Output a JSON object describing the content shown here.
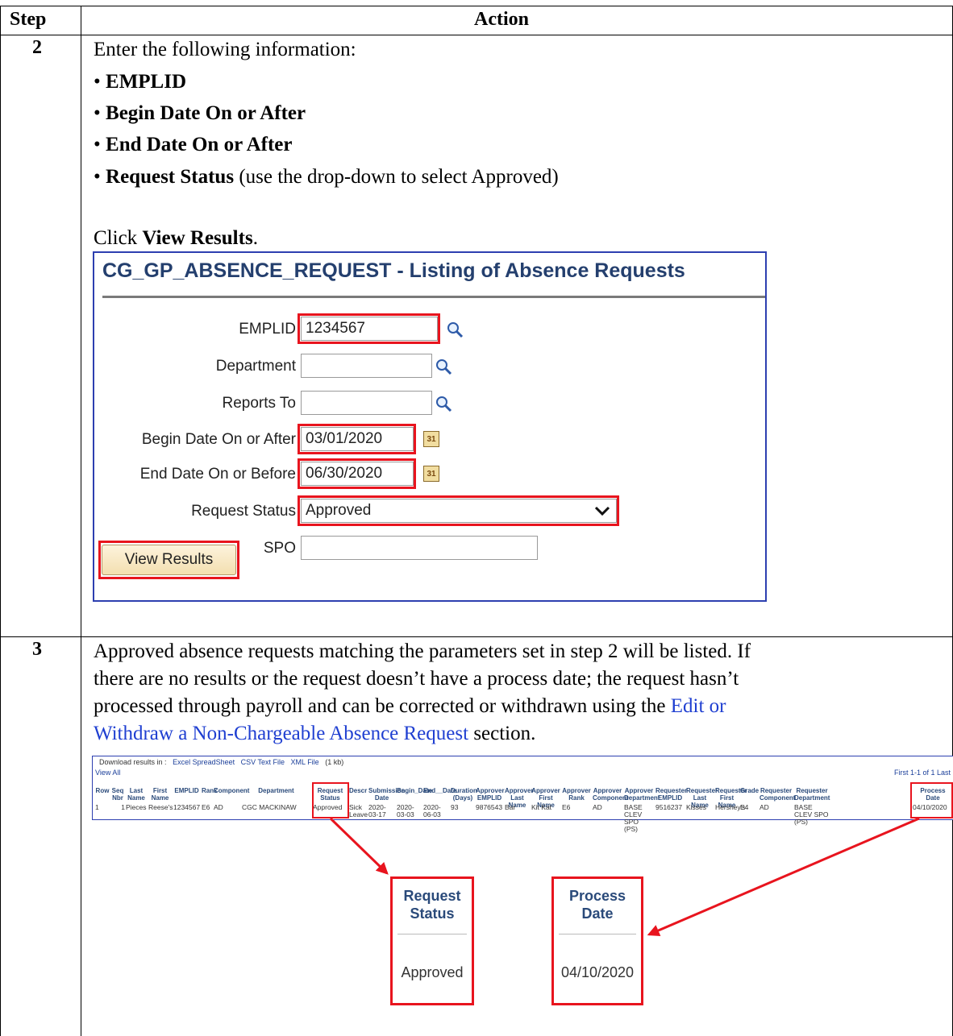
{
  "table": {
    "headers": {
      "step": "Step",
      "action": "Action"
    }
  },
  "step2": {
    "number": "2",
    "intro": "Enter the following information:",
    "bullets": [
      {
        "bold": "EMPLID",
        "rest": ""
      },
      {
        "bold": "Begin Date On or After",
        "rest": ""
      },
      {
        "bold": "End Date On or After",
        "rest": ""
      },
      {
        "bold": "Request Status",
        "rest": " (use the drop-down to select Approved)"
      }
    ],
    "click_prefix": "Click ",
    "click_bold": "View Results",
    "click_suffix": ".",
    "panel": {
      "title": "CG_GP_ABSENCE_REQUEST - Listing of Absence Requests",
      "fields": {
        "emplid": {
          "label": "EMPLID",
          "value": "1234567"
        },
        "department": {
          "label": "Department",
          "value": ""
        },
        "reports_to": {
          "label": "Reports To",
          "value": ""
        },
        "begin_date": {
          "label": "Begin Date On or After",
          "value": "03/01/2020"
        },
        "end_date": {
          "label": "End Date On or Before",
          "value": "06/30/2020"
        },
        "request_status": {
          "label": "Request Status",
          "value": "Approved"
        },
        "spo": {
          "label": "SPO",
          "value": ""
        }
      },
      "calendar_glyph": "31",
      "button": "View Results"
    }
  },
  "step3": {
    "number": "3",
    "para_line1": "Approved absence requests matching the parameters set in step 2 will be listed. If",
    "para_line2": "there are no results or the request doesn’t have a process date; the request hasn’t",
    "para_line3_pre": "processed through payroll and can be corrected or withdrawn using the ",
    "para_line3_link": "Edit or",
    "para_line4_link": "Withdraw a Non-Chargeable Absence Request",
    "para_line4_post": " section.",
    "results": {
      "download_label": "Download results in :",
      "download_links": [
        "Excel SpreadSheet",
        "CSV Text File",
        "XML File"
      ],
      "file_size": "(1 kb)",
      "view_all": "View All",
      "pager": "First  1-1 of 1  Last",
      "columns": [
        "Row",
        "Seq Nbr",
        "Last Name",
        "First Name",
        "EMPLID",
        "Rank",
        "Component",
        "Department",
        "Request Status",
        "Descr",
        "Submission Date",
        "Begin_Date",
        "End__Date",
        "Duration (Days)",
        "Approver EMPLID",
        "Approver Last Name",
        "Approver First Name",
        "Approver Rank",
        "Approver Component",
        "Approver Department",
        "Requester EMPLID",
        "Requester Last Name",
        "Requester First Name",
        "Grade",
        "Requester Component",
        "Requester Department",
        "Process Date"
      ],
      "row": [
        "1",
        "1",
        "Pieces",
        "Reese's",
        "1234567",
        "E6",
        "AD",
        "CGC MACKINAW",
        "Approved",
        "Sick Leave",
        "2020-03-17",
        "2020-03-03",
        "2020-06-03",
        "93",
        "9876543",
        "Bar",
        "Kit Kat",
        "E6",
        "AD",
        "BASE CLEV SPO (PS)",
        "9516237",
        "Kisses",
        "Hershey's",
        "E4",
        "AD",
        "BASE CLEV SPO (PS)",
        "04/10/2020"
      ]
    },
    "zoom_status": {
      "header_line1": "Request",
      "header_line2": "Status",
      "value": "Approved"
    },
    "zoom_process": {
      "header_line1": "Process",
      "header_line2": "Date",
      "value": "04/10/2020"
    }
  }
}
